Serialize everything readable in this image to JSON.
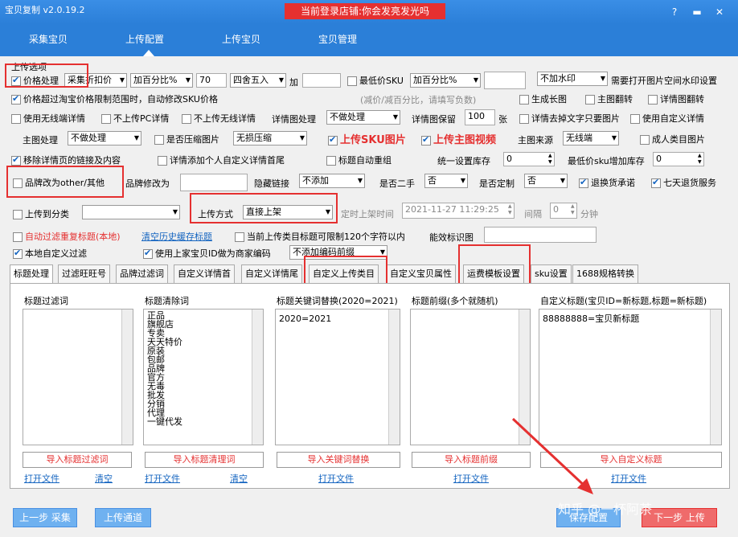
{
  "window": {
    "title": "宝贝复制 v2.0.19.2",
    "login_banner": "当前登录店铺:你会发亮发光吗"
  },
  "nav": {
    "tabs": [
      "采集宝贝",
      "上传配置",
      "上传宝贝",
      "宝贝管理"
    ],
    "active": "上传配置"
  },
  "section_title": "上传选项",
  "row1": {
    "price_label": "价格处理",
    "price_mode": "采集折扣价",
    "price_calc": "加百分比%",
    "price_value": "70",
    "rounding": "四舍五入",
    "plus_label": "加",
    "plus_value": "",
    "min_sku_label": "最低价SKU",
    "min_sku_calc": "加百分比%",
    "min_sku_value": "",
    "watermark": "不加水印",
    "watermark_note": "需要打开图片空间水印设置"
  },
  "row2": {
    "auto_adjust_label": "价格超过淘宝价格限制范围时，自动修改SKU价格",
    "auto_adjust_note": "(减价/减百分比，请填写负数)",
    "gen_long_img": "生成长图",
    "main_flip": "主图翻转",
    "detail_flip": "详情图翻转"
  },
  "row3": {
    "wireless_detail": "使用无线端详情",
    "no_pc_detail": "不上传PC详情",
    "no_wireless_detail": "不上传无线详情",
    "detail_img_proc_label": "详情图处理",
    "detail_img_proc": "不做处理",
    "detail_keep_label": "详情图保留",
    "detail_keep_value": "100",
    "detail_keep_unit": "张",
    "remove_text_img": "详情去掉文字只要图片",
    "custom_detail": "使用自定义详情"
  },
  "row4": {
    "main_proc_label": "主图处理",
    "main_proc": "不做处理",
    "compress_label": "是否压缩图片",
    "compress": "无损压缩",
    "upload_sku_img": "上传SKU图片",
    "upload_main_video": "上传主图视频",
    "main_src_label": "主图来源",
    "main_src": "无线端",
    "adult_img": "成人类目图片"
  },
  "row5": {
    "remove_links": "移除详情页的链接及内容",
    "add_custom_header": "详情添加个人自定义详情首尾",
    "title_regroup": "标题自动重组",
    "unify_stock_label": "统一设置库存",
    "unify_stock": "0",
    "min_sku_stock_label": "最低价sku增加库存",
    "min_sku_stock": "0"
  },
  "row6": {
    "brand_other": "品牌改为other/其他",
    "brand_change_label": "品牌修改为",
    "brand_change_value": "",
    "hide_link_label": "隐藏链接",
    "hide_link": "不添加",
    "second_hand_label": "是否二手",
    "second_hand": "否",
    "custom_made_label": "是否定制",
    "custom_made": "否",
    "return_promise": "退换货承诺",
    "seven_day_return": "七天退货服务"
  },
  "row7": {
    "upload_to_category": "上传到分类",
    "category": "",
    "upload_mode_label": "上传方式",
    "upload_mode": "直接上架",
    "scheduled_label": "定时上架时间",
    "scheduled_time": "2021-11-27 11:29:25",
    "interval_label": "间隔",
    "interval_value": "0",
    "interval_unit": "分钟"
  },
  "row8": {
    "auto_filter_dup": "自动过滤重复标题(本地)",
    "clear_cache": "清空历史缓存标题",
    "limit_120": "当前上传类目标题可限制120个字符以内",
    "efficacy_label": "能效标识图",
    "efficacy_value": ""
  },
  "row9": {
    "local_filter": "本地自定义过滤",
    "use_prev_id": "使用上家宝贝ID做为商家编码",
    "code_prefix": "不添加编码前缀"
  },
  "tabs": [
    "标题处理",
    "过滤旺旺号",
    "品牌过滤词",
    "自定义详情首",
    "自定义详情尾",
    "自定义上传类目",
    "自定义宝贝属性",
    "运费模板设置",
    "sku设置",
    "1688规格转换"
  ],
  "columns": [
    {
      "label": "标题过滤词",
      "text": "",
      "import": "导入标题过滤词",
      "links": [
        "打开文件",
        "清空"
      ]
    },
    {
      "label": "标题清除词",
      "text": "正品\n旗舰店\n专卖\n天天特价\n原装\n包邮\n品牌\n官方\n无毒\n批发\n分销\n代理\n一键代发",
      "import": "导入标题清理词",
      "links": [
        "打开文件",
        "清空"
      ]
    },
    {
      "label": "标题关键词替换(2020=2021)",
      "text": "2020=2021",
      "import": "导入关键词替换",
      "links": [
        "打开文件"
      ]
    },
    {
      "label": "标题前缀(多个就随机)",
      "text": "",
      "import": "导入标题前缀",
      "links": [
        "打开文件"
      ]
    },
    {
      "label": "自定义标题(宝贝ID=新标题,标题=新标题)",
      "text": "88888888=宝贝新标题",
      "import": "导入自定义标题",
      "links": [
        "打开文件"
      ]
    }
  ],
  "bottom": {
    "prev": "上一步 采集",
    "channel": "上传通道",
    "save": "保存配置",
    "next": "下一步 上传",
    "watermark": "知乎 @一杯阿茶"
  },
  "colors": {
    "titlebar": "#2b7fd8",
    "accent_red": "#e53030",
    "link_blue": "#1565c0"
  }
}
